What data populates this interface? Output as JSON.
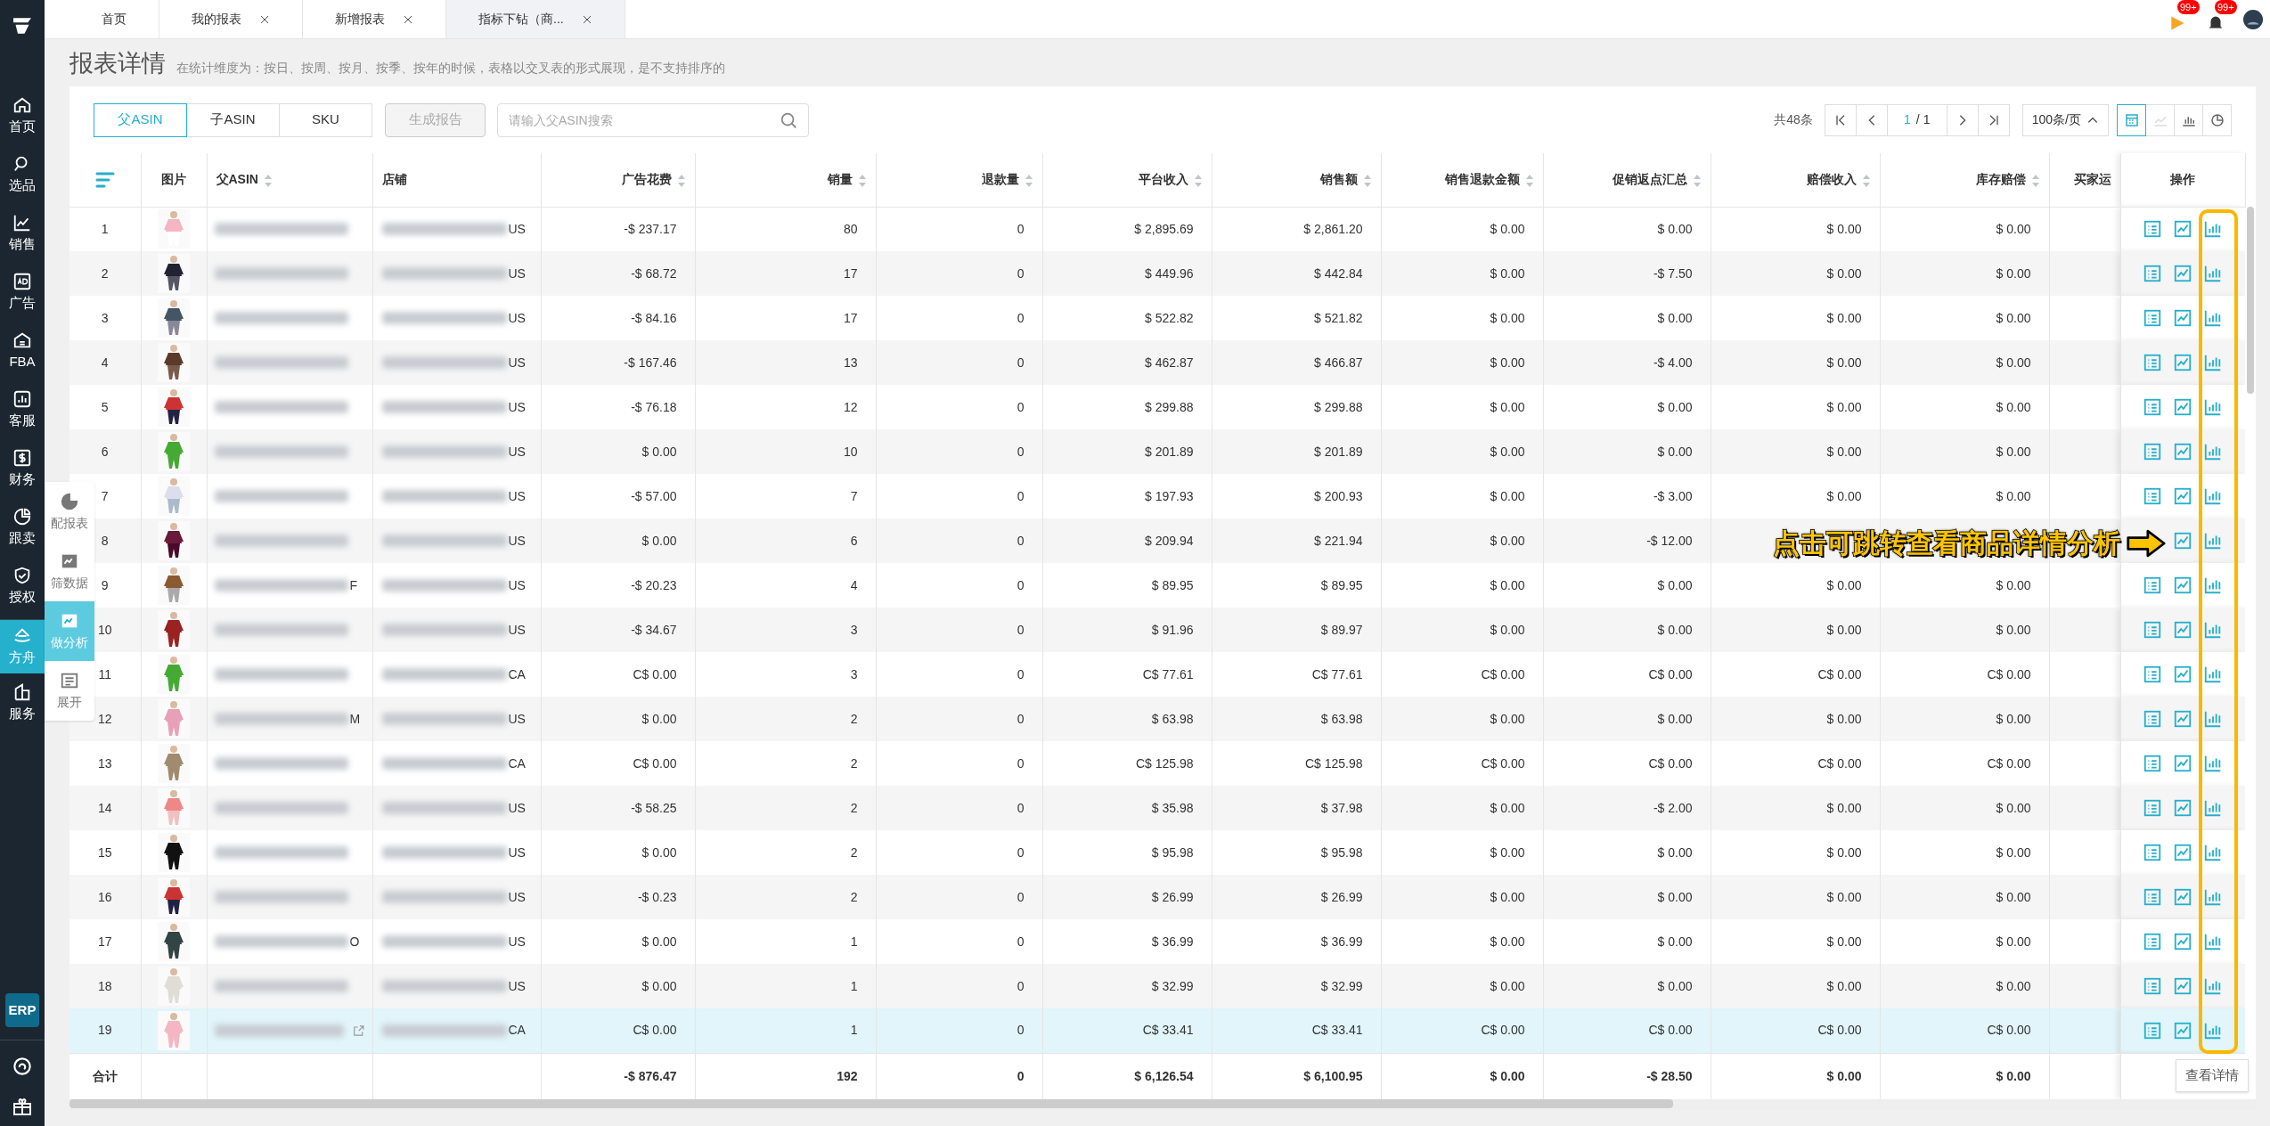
{
  "tabs": [
    {
      "label": "首页",
      "closable": false,
      "selected": false
    },
    {
      "label": "我的报表",
      "closable": true,
      "selected": false
    },
    {
      "label": "新增报表",
      "closable": true,
      "selected": false
    },
    {
      "label": "指标下钻（商...",
      "closable": true,
      "selected": true
    }
  ],
  "header_badges": [
    "99+",
    "99+"
  ],
  "sidebar": {
    "items": [
      {
        "label": "首页",
        "selected": false
      },
      {
        "label": "选品",
        "selected": false
      },
      {
        "label": "销售",
        "selected": false
      },
      {
        "label": "广告",
        "selected": false
      },
      {
        "label": "FBA",
        "selected": false
      },
      {
        "label": "客服",
        "selected": false
      },
      {
        "label": "财务",
        "selected": false
      },
      {
        "label": "跟卖",
        "selected": false
      },
      {
        "label": "授权",
        "selected": false
      },
      {
        "label": "方舟",
        "selected": true
      },
      {
        "label": "服务",
        "selected": false
      }
    ],
    "badge": "ERP"
  },
  "float_menu": [
    {
      "label": "配报表",
      "selected": false
    },
    {
      "label": "筛数据",
      "selected": false
    },
    {
      "label": "做分析",
      "selected": true
    },
    {
      "label": "展开",
      "selected": false
    }
  ],
  "page": {
    "title": "报表详情",
    "note": "在统计维度为：按日、按周、按月、按季、按年的时候，表格以交叉表的形式展现，是不支持排序的"
  },
  "toolbar": {
    "segments": [
      {
        "label": "父ASIN",
        "selected": true
      },
      {
        "label": "子ASIN",
        "selected": false
      },
      {
        "label": "SKU",
        "selected": false
      }
    ],
    "generate_button": {
      "label": "生成报告",
      "disabled": true
    },
    "search": {
      "placeholder": "请输入父ASIN搜索"
    },
    "total": "共48条",
    "page": "1",
    "pages": "/ 1",
    "page_size": "100条/页",
    "views": [
      {
        "selected": true,
        "disabled": false
      },
      {
        "selected": false,
        "disabled": true
      },
      {
        "selected": false,
        "disabled": false
      },
      {
        "selected": false,
        "disabled": false
      }
    ]
  },
  "table": {
    "columns": [
      {
        "label": "图片",
        "sortable": false
      },
      {
        "label": "父ASIN",
        "sortable": true
      },
      {
        "label": "店铺",
        "sortable": false
      },
      {
        "label": "广告花费",
        "sortable": true
      },
      {
        "label": "销量",
        "sortable": true
      },
      {
        "label": "退款量",
        "sortable": true
      },
      {
        "label": "平台收入",
        "sortable": true
      },
      {
        "label": "销售额",
        "sortable": true
      },
      {
        "label": "销售退款金额",
        "sortable": true
      },
      {
        "label": "促销返点汇总",
        "sortable": true
      },
      {
        "label": "赔偿收入",
        "sortable": true
      },
      {
        "label": "库存赔偿",
        "sortable": true
      },
      {
        "label": "买家运",
        "sortable": false
      },
      {
        "label": "操作",
        "sortable": false
      }
    ],
    "rows": [
      {
        "no": "1",
        "cells": [
          "",
          "",
          "US",
          "-$ 237.17",
          "80",
          "0",
          "$ 2,895.69",
          "$ 2,861.20",
          "$ 0.00",
          "$ 0.00",
          "$ 0.00",
          "$ 0.00"
        ],
        "hovered": false,
        "covered": false
      },
      {
        "no": "2",
        "cells": [
          "",
          "",
          "US",
          "-$ 68.72",
          "17",
          "0",
          "$ 449.96",
          "$ 442.84",
          "$ 0.00",
          "-$ 7.50",
          "$ 0.00",
          "$ 0.00"
        ],
        "hovered": false,
        "covered": false
      },
      {
        "no": "3",
        "cells": [
          "",
          "",
          "US",
          "-$ 84.16",
          "17",
          "0",
          "$ 522.82",
          "$ 521.82",
          "$ 0.00",
          "$ 0.00",
          "$ 0.00",
          "$ 0.00"
        ],
        "hovered": false,
        "covered": false
      },
      {
        "no": "4",
        "cells": [
          "",
          "",
          "US",
          "-$ 167.46",
          "13",
          "0",
          "$ 462.87",
          "$ 466.87",
          "$ 0.00",
          "-$ 4.00",
          "$ 0.00",
          "$ 0.00"
        ],
        "hovered": false,
        "covered": false
      },
      {
        "no": "5",
        "cells": [
          "",
          "",
          "US",
          "-$ 76.18",
          "12",
          "0",
          "$ 299.88",
          "$ 299.88",
          "$ 0.00",
          "$ 0.00",
          "$ 0.00",
          "$ 0.00"
        ],
        "hovered": false,
        "covered": false
      },
      {
        "no": "6",
        "cells": [
          "",
          "",
          "US",
          "$ 0.00",
          "10",
          "0",
          "$ 201.89",
          "$ 201.89",
          "$ 0.00",
          "$ 0.00",
          "$ 0.00",
          "$ 0.00"
        ],
        "hovered": false,
        "covered": false
      },
      {
        "no": "7",
        "cells": [
          "",
          "",
          "US",
          "-$ 57.00",
          "7",
          "0",
          "$ 197.93",
          "$ 200.93",
          "$ 0.00",
          "-$ 3.00",
          "$ 0.00",
          "$ 0.00"
        ],
        "hovered": false,
        "covered": false
      },
      {
        "no": "8",
        "cells": [
          "",
          "",
          "US",
          "$ 0.00",
          "6",
          "0",
          "$ 209.94",
          "$ 221.94",
          "$ 0.00",
          "-$ 12.00"
        ],
        "hovered": false,
        "covered": true
      },
      {
        "no": "9",
        "cells": [
          "",
          "F",
          "US",
          "-$ 20.23",
          "4",
          "0",
          "$ 89.95",
          "$ 89.95",
          "$ 0.00",
          "$ 0.00",
          "$ 0.00",
          "$ 0.00"
        ],
        "hovered": false,
        "covered": false
      },
      {
        "no": "10",
        "cells": [
          "",
          "",
          "US",
          "-$ 34.67",
          "3",
          "0",
          "$ 91.96",
          "$ 89.97",
          "$ 0.00",
          "$ 0.00",
          "$ 0.00",
          "$ 0.00"
        ],
        "hovered": false,
        "covered": false
      },
      {
        "no": "11",
        "cells": [
          "",
          "",
          "CA",
          "C$ 0.00",
          "3",
          "0",
          "C$ 77.61",
          "C$ 77.61",
          "C$ 0.00",
          "C$ 0.00",
          "C$ 0.00",
          "C$ 0.00"
        ],
        "hovered": false,
        "covered": false
      },
      {
        "no": "12",
        "cells": [
          "",
          "M",
          "US",
          "$ 0.00",
          "2",
          "0",
          "$ 63.98",
          "$ 63.98",
          "$ 0.00",
          "$ 0.00",
          "$ 0.00",
          "$ 0.00"
        ],
        "hovered": false,
        "covered": false
      },
      {
        "no": "13",
        "cells": [
          "",
          "",
          "CA",
          "C$ 0.00",
          "2",
          "0",
          "C$ 125.98",
          "C$ 125.98",
          "C$ 0.00",
          "C$ 0.00",
          "C$ 0.00",
          "C$ 0.00"
        ],
        "hovered": false,
        "covered": false
      },
      {
        "no": "14",
        "cells": [
          "",
          "",
          "US",
          "-$ 58.25",
          "2",
          "0",
          "$ 35.98",
          "$ 37.98",
          "$ 0.00",
          "-$ 2.00",
          "$ 0.00",
          "$ 0.00"
        ],
        "hovered": false,
        "covered": false
      },
      {
        "no": "15",
        "cells": [
          "",
          "",
          "US",
          "$ 0.00",
          "2",
          "0",
          "$ 95.98",
          "$ 95.98",
          "$ 0.00",
          "$ 0.00",
          "$ 0.00",
          "$ 0.00"
        ],
        "hovered": false,
        "covered": false
      },
      {
        "no": "16",
        "cells": [
          "",
          "",
          "US",
          "-$ 0.23",
          "2",
          "0",
          "$ 26.99",
          "$ 26.99",
          "$ 0.00",
          "$ 0.00",
          "$ 0.00",
          "$ 0.00"
        ],
        "hovered": false,
        "covered": false
      },
      {
        "no": "17",
        "cells": [
          "",
          "O",
          "US",
          "$ 0.00",
          "1",
          "0",
          "$ 36.99",
          "$ 36.99",
          "$ 0.00",
          "$ 0.00",
          "$ 0.00",
          "$ 0.00"
        ],
        "hovered": false,
        "covered": false
      },
      {
        "no": "18",
        "cells": [
          "",
          "",
          "US",
          "$ 0.00",
          "1",
          "0",
          "$ 32.99",
          "$ 32.99",
          "$ 0.00",
          "$ 0.00",
          "$ 0.00",
          "$ 0.00"
        ],
        "hovered": false,
        "covered": false
      },
      {
        "no": "19",
        "cells": [
          "",
          "",
          "CA",
          "C$ 0.00",
          "1",
          "0",
          "C$ 33.41",
          "C$ 33.41",
          "C$ 0.00",
          "C$ 0.00",
          "C$ 0.00",
          "C$ 0.00"
        ],
        "hovered": true,
        "covered": false
      }
    ],
    "total_row": {
      "label": "合计",
      "cells": [
        "",
        "",
        "",
        "-$ 876.47",
        "192",
        "0",
        "$ 6,126.54",
        "$ 6,100.95",
        "$ 0.00",
        "-$ 28.50",
        "$ 0.00",
        "$ 0.00"
      ]
    }
  },
  "annotation": "点击可跳转查看商品详情分析",
  "tooltip": "查看详情"
}
